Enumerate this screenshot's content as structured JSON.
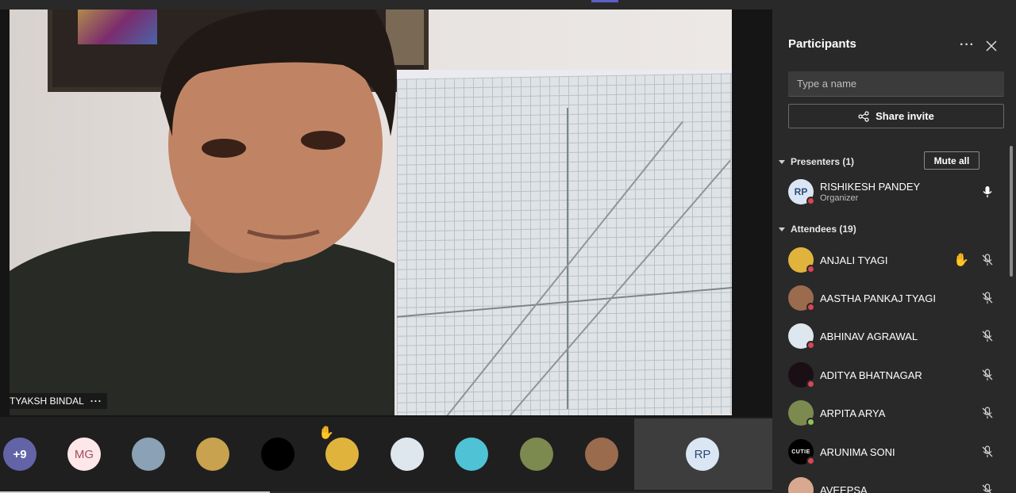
{
  "video": {
    "speaker_label": "TYAKSH BINDAL"
  },
  "strip": {
    "overflow_count": "+9",
    "tiles": [
      {
        "initials": "MG",
        "color": "#fde7e9",
        "text_color": "#9f5058"
      },
      {
        "initials": "",
        "color": "#8aa1b6",
        "icon": "photo-avatar"
      },
      {
        "initials": "",
        "color": "#c8a24e",
        "icon": "photo-avatar"
      },
      {
        "initials": "",
        "color": "#000000",
        "icon": "black-avatar"
      },
      {
        "initials": "",
        "color": "#e0b43c",
        "icon": "minion-avatar"
      },
      {
        "initials": "",
        "color": "#dfe7ee",
        "icon": "photo-avatar"
      },
      {
        "initials": "",
        "color": "#4fc3d5",
        "icon": "photo-avatar"
      },
      {
        "initials": "",
        "color": "#7c8a50",
        "icon": "photo-avatar"
      },
      {
        "initials": "",
        "color": "#9a6b4d",
        "icon": "photo-avatar"
      }
    ],
    "highlight": {
      "initials": "RP",
      "color": "#dbe6f5",
      "text_color": "#2b4a74"
    }
  },
  "panel": {
    "title": "Participants",
    "search_placeholder": "Type a name",
    "share_label": "Share invite",
    "presenters_label": "Presenters (1)",
    "mute_all_label": "Mute all",
    "attendees_label": "Attendees (19)",
    "presenters": [
      {
        "name": "RISHIKESH PANDEY",
        "role": "Organizer",
        "initials": "RP",
        "avatar_color": "#dbe6f5",
        "mic": "mic-on"
      }
    ],
    "attendees": [
      {
        "name": "ANJALI TYAGI",
        "avatar_color": "#e0b43c",
        "hand_raised": true,
        "status": "red"
      },
      {
        "name": "AASTHA PANKAJ TYAGI",
        "avatar_color": "#9a6b4d",
        "hand_raised": false,
        "status": "red"
      },
      {
        "name": "ABHINAV AGRAWAL",
        "avatar_color": "#dfe7ee",
        "hand_raised": false,
        "status": "red"
      },
      {
        "name": "ADITYA BHATNAGAR",
        "avatar_color": "#1a0f14",
        "hand_raised": false,
        "status": "red"
      },
      {
        "name": "ARPITA ARYA",
        "avatar_color": "#7c8a50",
        "hand_raised": false,
        "status": "green"
      },
      {
        "name": "ARUNIMA SONI",
        "avatar_color": "#000000",
        "avatar_text": "CUTIE",
        "hand_raised": false,
        "status": "red"
      },
      {
        "name": "AVEEPSA",
        "avatar_color": "#d9a98f",
        "hand_raised": false,
        "status": "red"
      }
    ]
  },
  "colors": {
    "accent": "#5b5fc7",
    "hand": "#f1b634",
    "busy": "#d74654",
    "available": "#92c353"
  }
}
